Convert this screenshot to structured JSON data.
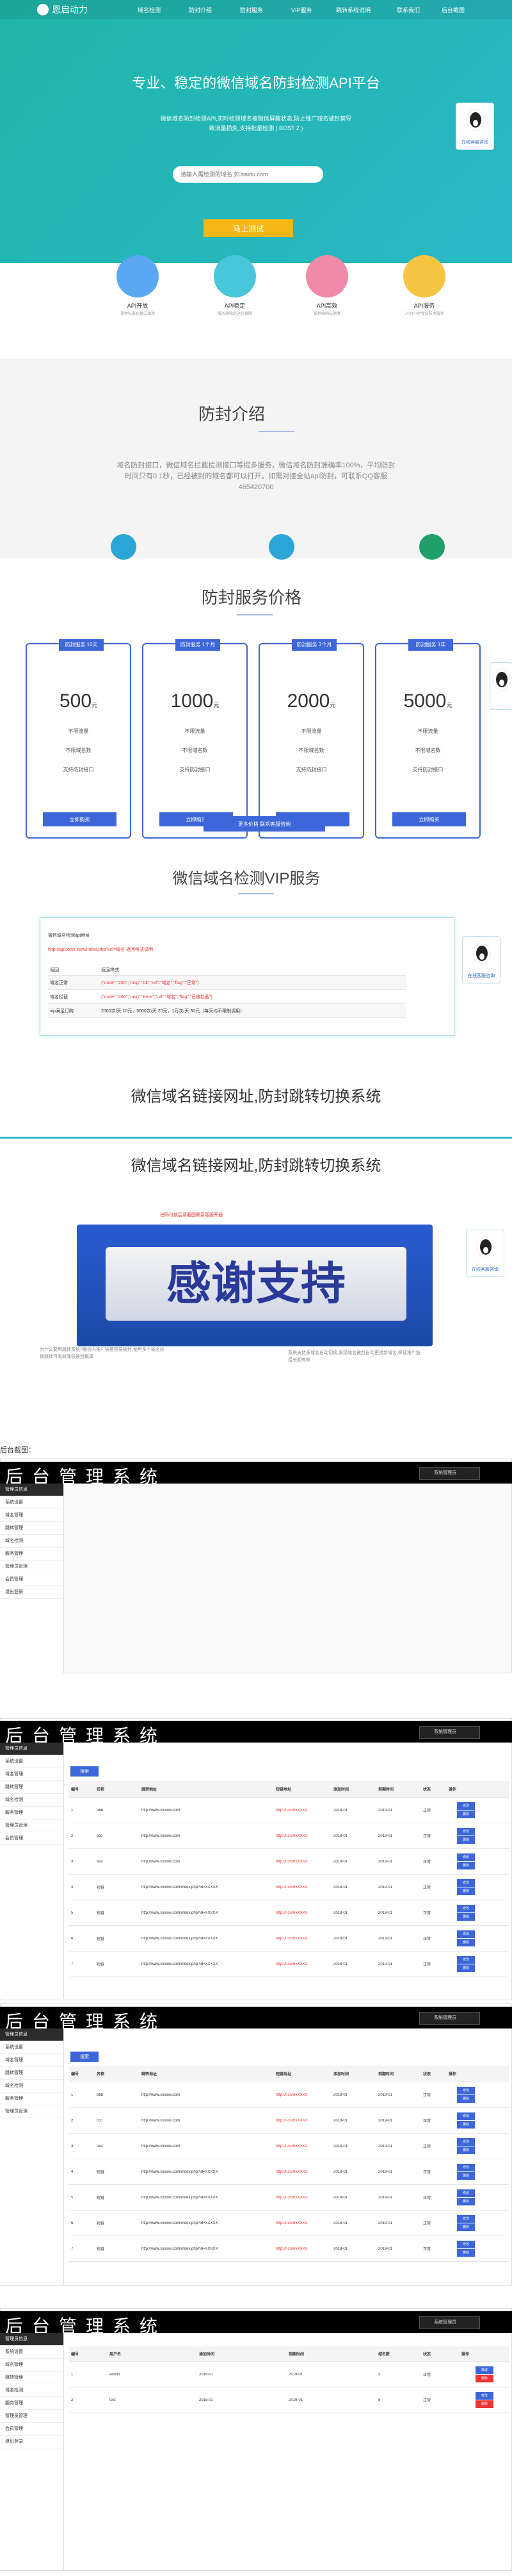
{
  "nav": {
    "brand": "恩启动力",
    "items": [
      "域名检测",
      "防封介绍",
      "防封服务",
      "VIP服务",
      "跳转系统说明"
    ],
    "extra": [
      "联系我们",
      "后台截图"
    ]
  },
  "hero": {
    "title": "专业、稳定的微信域名防封检测API平台",
    "intro": "微信域名防封检测API,实时检测域名被微信屏蔽状态,防止推广域名被封禁导致流量损失,支持批量检测 ( BOST 2 )",
    "search_placeholder": "请输入需检测的域名 如 baidu.com",
    "submit": "马上测试"
  },
  "qq": {
    "label": "在线客服咨询"
  },
  "features": [
    {
      "title": "API开放",
      "desc": "提供标准化接口调用"
    },
    {
      "title": "API稳定",
      "desc": "服务器稳定运行保障"
    },
    {
      "title": "API高效",
      "desc": "毫秒级响应速度"
    },
    {
      "title": "API服务",
      "desc": "7×24小时专业技术服务"
    }
  ],
  "intro": {
    "title": "防封介绍",
    "body": "域名防封接口，微信域名拦截检测接口等提多服务，微信域名防封准确率100%，平均防封时间只有0.1秒，已经被封的域名都可以打开。如需对接全站api防封，可联系QQ客服 465420700"
  },
  "pricing": {
    "title": "防封服务价格",
    "cards": [
      {
        "tag": "防封服务 10天",
        "price": "500",
        "unit": "元",
        "l1": "不限流量",
        "l2": "不限域名数",
        "l3": "支持防封接口",
        "btn": "立即购买"
      },
      {
        "tag": "防封服务 1个月",
        "price": "1000",
        "unit": "元",
        "l1": "不限流量",
        "l2": "不限域名数",
        "l3": "支持防封接口",
        "btn": "立即购买"
      },
      {
        "tag": "防封服务 3个月",
        "price": "2000",
        "unit": "元",
        "l1": "不限流量",
        "l2": "不限域名数",
        "l3": "支持防封接口",
        "btn": "立即购买"
      },
      {
        "tag": "防封服务 1年",
        "price": "5000",
        "unit": "元",
        "l1": "不限流量",
        "l2": "不限域名数",
        "l3": "支持防封接口",
        "btn": "立即购买"
      }
    ],
    "more": "更多价格 联系客服咨询"
  },
  "vip": {
    "title": "微信域名检测VIP服务",
    "head": "微信域名检测api地址",
    "url": "http://api.xxxx.com/index.php?url=域名 返回格式说明",
    "cols": [
      "返回",
      "返回样式"
    ],
    "rows": [
      {
        "k": "域名正常",
        "v": "{\"code\":\"200\",\"msg\":\"ok\",\"url\":\"域名\",\"flag\":\"正常\"}"
      },
      {
        "k": "域名拦截",
        "v": "{\"code\":\"400\",\"msg\":\"error\",\"url\":\"域名\",\"flag\":\"已被拦截\"}"
      },
      {
        "k": "vip满足订购",
        "v": "2000次/天 10元，5000次/天 20元，1万次/天 30元（每天均不限制调用）"
      }
    ]
  },
  "jump": {
    "title1": "微信域名链接网址,防封跳转切换系统",
    "title2": "微信域名链接网址,防封跳转切换系统",
    "banner": "感谢支持",
    "pay_note": "扫码付款后请截图联系客服开通",
    "note_left": "为什么要用跳转系统?微信内推广链接容易被封,使用多个域名轮换跳转可有效降低被封概率",
    "note_right": "系统支持多域名自动切换,发现域名被封自动更换新域名,保证推广链接长期有效"
  },
  "screens_label": "后台截图：",
  "admin": {
    "title": "后台管理系统",
    "user": "系统管理员",
    "sidebar": [
      "管理员信息",
      "系统设置",
      "域名管理",
      "跳转管理",
      "域名检测",
      "服务管理",
      "管理员管理",
      "会员管理",
      "退出登录"
    ],
    "search_btn": "搜索",
    "cols": [
      "编号",
      "名称",
      "跳转地址",
      "短链地址",
      "添加时间",
      "到期时间",
      "状态",
      "操作"
    ],
    "rows": [
      {
        "id": "1",
        "name": "bbb",
        "url": "http://www.xxxxxx.com",
        "short": "http://t.cn/RxXXXX",
        "t1": "2018-01",
        "t2": "2019-01",
        "st": "正常"
      },
      {
        "id": "2",
        "name": "ccc",
        "url": "http://www.xxxxxx.com",
        "short": "http://t.cn/RxXXXX",
        "t1": "2018-01",
        "t2": "2019-01",
        "st": "正常"
      },
      {
        "id": "3",
        "name": "test",
        "url": "http://www.xxxxxx.com",
        "short": "http://t.cn/RxXXXX",
        "t1": "2018-01",
        "t2": "2019-01",
        "st": "正常"
      },
      {
        "id": "4",
        "name": "短链",
        "url": "http://www.xxxxxx.com/index.php?id=XXXXX",
        "short": "http://t.cn/RxXXXX",
        "t1": "2018-01",
        "t2": "2019-01",
        "st": "正常"
      },
      {
        "id": "5",
        "name": "短链",
        "url": "http://www.xxxxxx.com/index.php?id=XXXXX",
        "short": "http://t.cn/RxXXXX",
        "t1": "2018-01",
        "t2": "2019-01",
        "st": "正常"
      },
      {
        "id": "6",
        "name": "短链",
        "url": "http://www.xxxxxx.com/index.php?id=XXXXX",
        "short": "http://t.cn/RxXXXX",
        "t1": "2018-01",
        "t2": "2019-01",
        "st": "正常"
      },
      {
        "id": "7",
        "name": "短链",
        "url": "http://www.xxxxxx.com/index.php?id=XXXXX",
        "short": "http://t.cn/RxXXXX",
        "t1": "2018-01",
        "t2": "2019-01",
        "st": "正常"
      }
    ],
    "btn_edit": "修改",
    "btn_del": "删除",
    "users": {
      "cols": [
        "编号",
        "用户名",
        "添加时间",
        "到期时间",
        "域名数",
        "状态",
        "操作"
      ],
      "rows": [
        {
          "id": "1",
          "name": "admin",
          "t1": "2018-01",
          "t2": "2019-01",
          "n": "3",
          "st": "正常"
        },
        {
          "id": "2",
          "name": "test",
          "t1": "2018-01",
          "t2": "2019-01",
          "n": "5",
          "st": "正常"
        }
      ]
    }
  },
  "colors": {
    "teal": "#1fb5a8",
    "blue": "#3d67d8",
    "yellow": "#f5b716",
    "red": "#e33"
  }
}
